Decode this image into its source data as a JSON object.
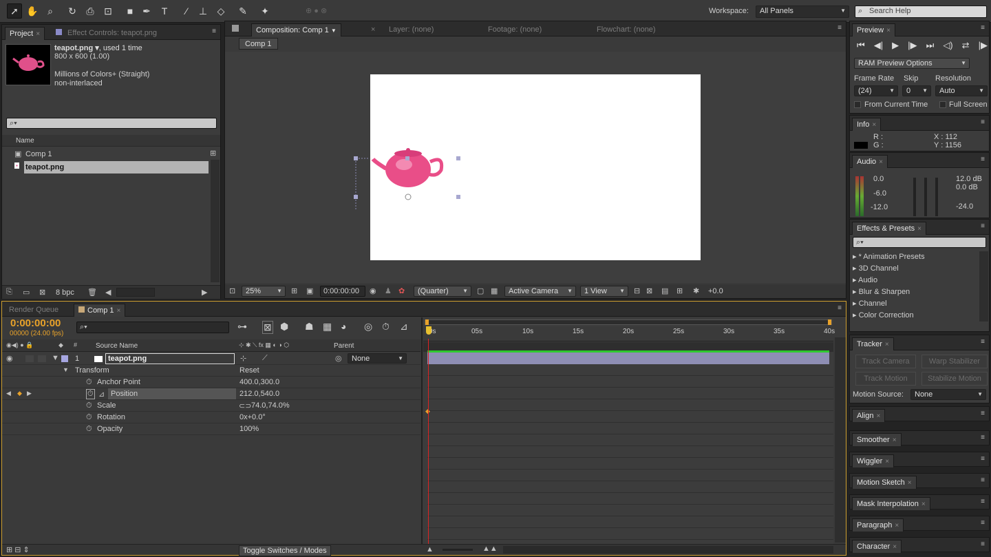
{
  "toolbar": {
    "tools": [
      "selection-tool-icon",
      "hand-tool-icon",
      "zoom-tool-icon",
      "rotation-tool-icon",
      "camera-tool-icon",
      "pan-behind-tool-icon",
      "rectangle-tool-icon",
      "pen-tool-icon",
      "type-tool-icon",
      "brush-tool-icon",
      "clone-stamp-tool-icon",
      "eraser-tool-icon",
      "roto-brush-tool-icon",
      "puppet-pin-tool-icon"
    ],
    "workspace_label": "Workspace:",
    "workspace_value": "All Panels",
    "search_help_placeholder": "Search Help"
  },
  "project": {
    "tab_project": "Project",
    "tab_effect_controls": "Effect Controls: teapot.png",
    "item_name": "teapot.png ▾",
    "item_used": ", used 1 time",
    "item_size": "800 x 600 (1.00)",
    "item_colors": "Millions of Colors+ (Straight)",
    "item_interlace": "non-interlaced",
    "col_name": "Name",
    "items": [
      "Comp 1",
      "teapot.png"
    ],
    "bpc": "8 bpc"
  },
  "composition": {
    "tab_comp": "Composition: Comp 1",
    "tab_layer": "Layer: (none)",
    "tab_footage": "Footage: (none)",
    "tab_flowchart": "Flowchart: (none)",
    "subtab": "Comp 1",
    "zoom": "25%",
    "timecode": "0:00:00:00",
    "resolution": "(Quarter)",
    "camera": "Active Camera",
    "views": "1 View",
    "exposure": "+0.0"
  },
  "preview": {
    "tab": "Preview",
    "ram_options": "RAM Preview Options",
    "frame_rate_label": "Frame Rate",
    "skip_label": "Skip",
    "resolution_label": "Resolution",
    "frame_rate": "(24)",
    "skip": "0",
    "resolution": "Auto",
    "from_current": "From Current Time",
    "full_screen": "Full Screen"
  },
  "info": {
    "tab": "Info",
    "r": "R :",
    "g": "G :",
    "x": "X : 112",
    "y": "Y : 1156"
  },
  "audio": {
    "tab": "Audio",
    "left_levels": [
      "0.0",
      "-6.0",
      "-12.0"
    ],
    "right_levels": [
      "12.0 dB",
      "0.0 dB",
      "-24.0"
    ]
  },
  "effects": {
    "tab": "Effects & Presets",
    "items": [
      "* Animation Presets",
      "3D Channel",
      "Audio",
      "Blur & Sharpen",
      "Channel",
      "Color Correction"
    ]
  },
  "tracker": {
    "tab": "Tracker",
    "track_camera": "Track Camera",
    "warp_stabilizer": "Warp Stabilizer",
    "track_motion": "Track Motion",
    "stabilize_motion": "Stabilize Motion",
    "motion_source_label": "Motion Source:",
    "motion_source": "None"
  },
  "side_tabs": [
    "Align",
    "Smoother",
    "Wiggler",
    "Motion Sketch",
    "Mask Interpolation",
    "Paragraph",
    "Character"
  ],
  "timeline": {
    "tab_render": "Render Queue",
    "tab_comp": "Comp 1",
    "timecode": "0:00:00:00",
    "frames": "00000 (24.00 fps)",
    "col_source": "Source Name",
    "col_parent": "Parent",
    "layer_num": "1",
    "layer_name": "teapot.png",
    "parent_value": "None",
    "transform": "Transform",
    "reset": "Reset",
    "properties": [
      {
        "name": "Anchor Point",
        "value": "400.0,300.0"
      },
      {
        "name": "Position",
        "value": "212.0,540.0"
      },
      {
        "name": "Scale",
        "value": "74.0,74.0%"
      },
      {
        "name": "Rotation",
        "value": "0x+0.0°"
      },
      {
        "name": "Opacity",
        "value": "100%"
      }
    ],
    "ruler": [
      "0s",
      "05s",
      "10s",
      "15s",
      "20s",
      "25s",
      "30s",
      "35s",
      "40s"
    ],
    "toggle": "Toggle Switches / Modes"
  }
}
